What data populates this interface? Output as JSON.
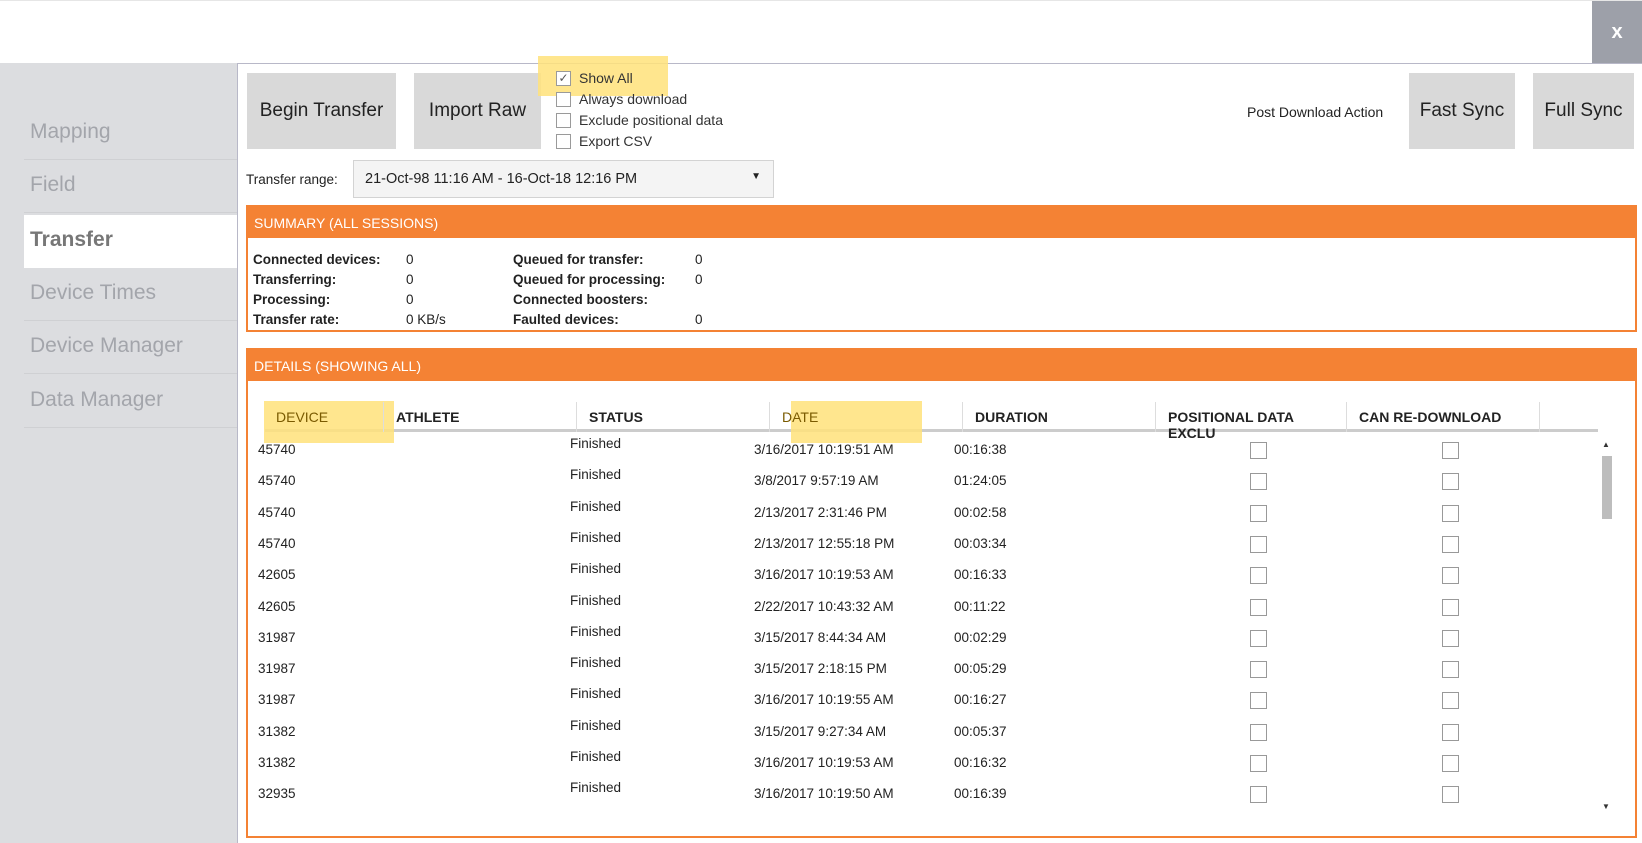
{
  "window": {
    "close_label": "x"
  },
  "sidebar": {
    "items": [
      {
        "label": "Mapping"
      },
      {
        "label": "Field"
      },
      {
        "label": "Transfer"
      },
      {
        "label": "Device Times"
      },
      {
        "label": "Device Manager"
      },
      {
        "label": "Data Manager"
      }
    ],
    "active": "Transfer"
  },
  "toolbar": {
    "begin_transfer": "Begin Transfer",
    "import_raw": "Import Raw",
    "post_download_action": "Post Download Action",
    "fast_sync": "Fast Sync",
    "full_sync": "Full Sync",
    "options": [
      {
        "label": "Show All",
        "checked": true
      },
      {
        "label": "Always download",
        "checked": false
      },
      {
        "label": "Exclude positional data",
        "checked": false
      },
      {
        "label": "Export CSV",
        "checked": false
      }
    ],
    "transfer_range_label": "Transfer range:",
    "transfer_range_value": "21-Oct-98 11:16 AM - 16-Oct-18 12:16 PM"
  },
  "summary": {
    "title": "SUMMARY (ALL SESSIONS)",
    "left": [
      {
        "label": "Connected devices:",
        "value": "0"
      },
      {
        "label": "Transferring:",
        "value": "0"
      },
      {
        "label": "Processing:",
        "value": "0"
      },
      {
        "label": "Transfer rate:",
        "value": "0 KB/s"
      }
    ],
    "right": [
      {
        "label": "Queued for transfer:",
        "value": "0"
      },
      {
        "label": "Queued for processing:",
        "value": "0"
      },
      {
        "label": "Connected boosters:",
        "value": ""
      },
      {
        "label": "Faulted devices:",
        "value": "0"
      }
    ]
  },
  "details": {
    "title": "DETAILS (SHOWING ALL)",
    "columns": [
      "DEVICE",
      "ATHLETE",
      "STATUS",
      "DATE",
      "DURATION",
      "POSITIONAL DATA EXCLU",
      "CAN RE-DOWNLOAD"
    ],
    "rows": [
      [
        "45740",
        "",
        "Finished",
        "3/16/2017 10:19:51 AM",
        "00:16:38"
      ],
      [
        "45740",
        "",
        "Finished",
        "3/8/2017 9:57:19 AM",
        "01:24:05"
      ],
      [
        "45740",
        "",
        "Finished",
        "2/13/2017 2:31:46 PM",
        "00:02:58"
      ],
      [
        "45740",
        "",
        "Finished",
        "2/13/2017 12:55:18 PM",
        "00:03:34"
      ],
      [
        "42605",
        "",
        "Finished",
        "3/16/2017 10:19:53 AM",
        "00:16:33"
      ],
      [
        "42605",
        "",
        "Finished",
        "2/22/2017 10:43:32 AM",
        "00:11:22"
      ],
      [
        "31987",
        "",
        "Finished",
        "3/15/2017 8:44:34 AM",
        "00:02:29"
      ],
      [
        "31987",
        "",
        "Finished",
        "3/15/2017 2:18:15 PM",
        "00:05:29"
      ],
      [
        "31987",
        "",
        "Finished",
        "3/16/2017 10:19:55 AM",
        "00:16:27"
      ],
      [
        "31382",
        "",
        "Finished",
        "3/15/2017 9:27:34 AM",
        "00:05:37"
      ],
      [
        "31382",
        "",
        "Finished",
        "3/16/2017 10:19:53 AM",
        "00:16:32"
      ],
      [
        "32935",
        "",
        "Finished",
        "3/16/2017 10:19:50 AM",
        "00:16:39"
      ]
    ]
  },
  "colors": {
    "accent": "#f48234",
    "highlight": "#ffe27a"
  }
}
